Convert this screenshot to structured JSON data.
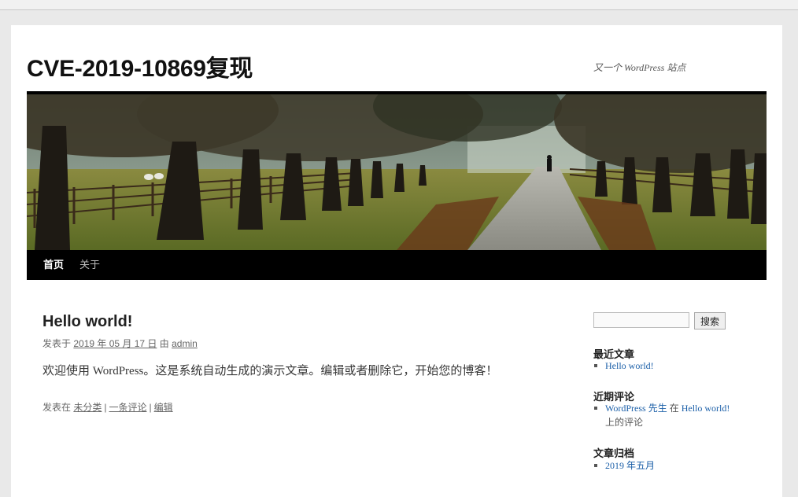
{
  "site": {
    "title": "CVE-2019-10869复现",
    "description": "又一个 WordPress 站点"
  },
  "nav": {
    "home": "首页",
    "about": "关于"
  },
  "post": {
    "title": "Hello world!",
    "meta_prefix": "发表于",
    "date": "2019 年 05 月 17 日",
    "by": "由",
    "author": "admin",
    "content": "欢迎使用 WordPress。这是系统自动生成的演示文章。编辑或者删除它，开始您的博客！",
    "foot_prefix": "发表在",
    "category": "未分类",
    "comments": "一条评论",
    "edit": "编辑",
    "separator": "|"
  },
  "sidebar": {
    "search_button": "搜索",
    "search_value": "",
    "recent_posts_title": "最近文章",
    "recent_posts": [
      "Hello world!"
    ],
    "recent_comments_title": "近期评论",
    "comment_author": "WordPress 先生",
    "comment_on": "在",
    "comment_post": "Hello world!",
    "comment_suffix": "上的评论",
    "archives_title": "文章归档",
    "archives": [
      "2019 年五月"
    ]
  },
  "colors": {
    "link": "#1b5fa8",
    "nav_bg": "#000000",
    "page_bg": "#e9e9e9"
  }
}
